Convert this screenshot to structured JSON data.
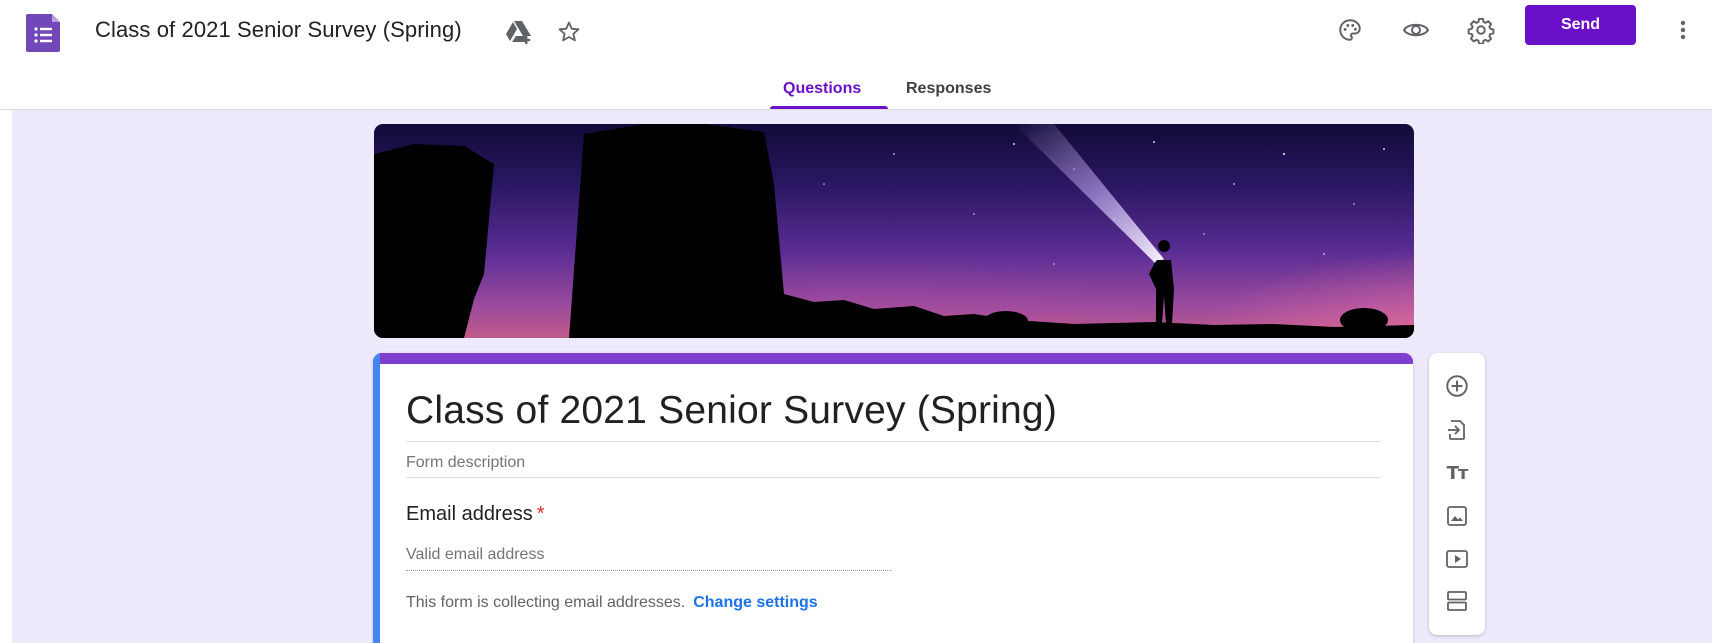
{
  "header": {
    "doc_title": "Class of 2021 Senior Survey (Spring)",
    "send_label": "Send",
    "accent_color": "#6a10c9",
    "icons": [
      "forms-app-icon",
      "drive-move-icon",
      "star-icon",
      "palette-icon",
      "preview-eye-icon",
      "settings-gear-icon",
      "more-vert-icon"
    ]
  },
  "tabs": {
    "questions_label": "Questions",
    "responses_label": "Responses",
    "active": "Questions"
  },
  "form": {
    "title": "Class of 2021 Senior Survey (Spring)",
    "description_placeholder": "Form description",
    "email_question_label": "Email address",
    "required_marker": "*",
    "email_placeholder": "Valid email address",
    "collect_note": "This form is collecting email addresses.",
    "change_settings_label": "Change settings",
    "theme_color": "#7e3fcf",
    "selected_indicator_color": "#4285f4"
  },
  "toolbar": {
    "tools": [
      "add-question",
      "import-questions",
      "add-title-description",
      "add-image",
      "add-video",
      "add-section"
    ],
    "title_tool_glyph": "Tт"
  }
}
